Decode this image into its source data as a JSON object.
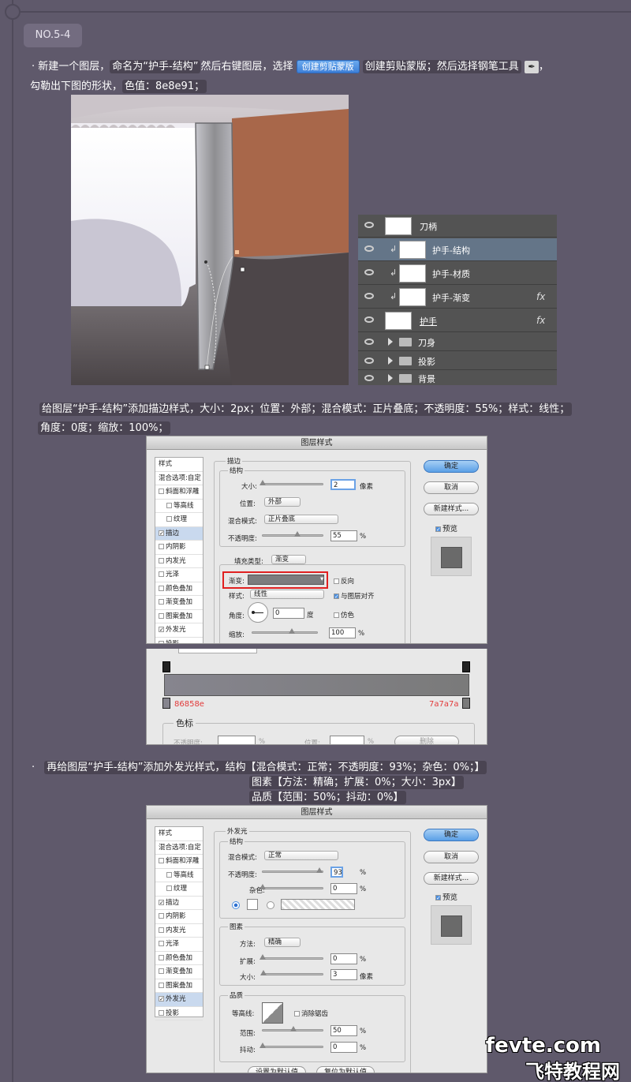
{
  "section_tag": "NO.5-4",
  "step1": {
    "bullet": "·",
    "text_a": "新建一个图层，",
    "text_b": "命名为“护手-结构”",
    "text_c": "然后右键图层，选择",
    "menu_button": "创建剪贴蒙版",
    "text_d": "创建剪贴蒙版；然后选择钢笔工具",
    "pen_icon": "pen-tool-icon",
    "text_e": "，",
    "line2_a": "勾勒出下图的形状，",
    "line2_b": "色值：8e8e91；"
  },
  "layers": [
    {
      "name": "刀柄",
      "selected": false,
      "clip": false,
      "fx": false,
      "group": false
    },
    {
      "name": "护手-结构",
      "selected": true,
      "clip": true,
      "fx": false,
      "group": false
    },
    {
      "name": "护手-材质",
      "selected": false,
      "clip": true,
      "fx": false,
      "group": false
    },
    {
      "name": "护手-渐变",
      "selected": false,
      "clip": true,
      "fx": true,
      "group": false
    },
    {
      "name": "护手",
      "selected": false,
      "clip": false,
      "fx": true,
      "group": false
    },
    {
      "name": "刀身",
      "selected": false,
      "clip": false,
      "fx": false,
      "group": true
    },
    {
      "name": "投影",
      "selected": false,
      "clip": false,
      "fx": false,
      "group": true
    },
    {
      "name": "背景",
      "selected": false,
      "clip": false,
      "fx": false,
      "group": true
    }
  ],
  "fx_label": "fx",
  "step2": {
    "line1": "给图层“护手-结构”添加描边样式，大小：2px；位置：外部；混合模式：正片叠底；不透明度：55%；样式：线性；",
    "line2": "角度：0度；缩放：100%；"
  },
  "dialog1": {
    "title": "图层样式",
    "styles_header": "样式",
    "blend_options": "混合选项:自定",
    "items": [
      "斜面和浮雕",
      "等高线",
      "纹理",
      "描边",
      "内阴影",
      "内发光",
      "光泽",
      "颜色叠加",
      "渐变叠加",
      "图案叠加",
      "外发光",
      "投影"
    ],
    "group_title": "描边",
    "struct_title": "结构",
    "size_label": "大小:",
    "size_value": "2",
    "size_unit": "像素",
    "position_label": "位置:",
    "position_value": "外部",
    "blend_label": "混合模式:",
    "blend_value": "正片叠底",
    "opacity_label": "不透明度:",
    "opacity_value": "55",
    "percent": "%",
    "fill_label": "填充类型:",
    "fill_value": "渐变",
    "gradient_label": "渐变:",
    "reverse_label": "反向",
    "style_label": "样式:",
    "style_value": "线性",
    "align_label": "与图层对齐",
    "angle_label": "角度:",
    "angle_value": "0",
    "angle_unit": "度",
    "dither_label": "仿色",
    "scale_label": "缩放:",
    "scale_value": "100",
    "ok": "确定",
    "cancel": "取消",
    "new_style": "新建样式...",
    "preview": "预览"
  },
  "gradient_editor": {
    "left_color": "86858e",
    "right_color": "7a7a7a",
    "stops_title": "色标",
    "opacity_label": "不透明度:",
    "percent": "%",
    "location_label": "位置:",
    "delete_label": "删除"
  },
  "step3": {
    "line1": "再给图层“护手-结构”添加外发光样式，结构【混合模式：正常；不透明度：93%；杂色：0%；】",
    "line2": "图素【方法：精确；扩展：0%；大小：3px】",
    "line3": "品质【范围：50%；抖动：0%】"
  },
  "dialog2": {
    "title": "图层样式",
    "styles_header": "样式",
    "blend_options": "混合选项:自定",
    "items": [
      "斜面和浮雕",
      "等高线",
      "纹理",
      "描边",
      "内阴影",
      "内发光",
      "光泽",
      "颜色叠加",
      "渐变叠加",
      "图案叠加",
      "外发光",
      "投影"
    ],
    "group_title": "外发光",
    "struct_title": "结构",
    "blend_label": "混合模式:",
    "blend_value": "正常",
    "opacity_label": "不透明度:",
    "opacity_value": "93",
    "noise_label": "杂色:",
    "noise_value": "0",
    "percent": "%",
    "elements_title": "图素",
    "method_label": "方法:",
    "method_value": "精确",
    "spread_label": "扩展:",
    "spread_value": "0",
    "size_label": "大小:",
    "size_value": "3",
    "size_unit": "像素",
    "quality_title": "品质",
    "contour_label": "等高线:",
    "antialias_label": "消除锯齿",
    "range_label": "范围:",
    "range_value": "50",
    "jitter_label": "抖动:",
    "jitter_value": "0",
    "default_btn": "设置为默认值",
    "reset_btn": "复位为默认值",
    "ok": "确定",
    "cancel": "取消",
    "new_style": "新建样式...",
    "preview": "预览"
  },
  "watermark": {
    "line1": "fevte.com",
    "line2": "飞特教程网"
  },
  "colors": {
    "background": "#5f596b",
    "highlight": "#4a4452",
    "guard_fill": "#8e8e91",
    "handle": "#a8674a"
  }
}
